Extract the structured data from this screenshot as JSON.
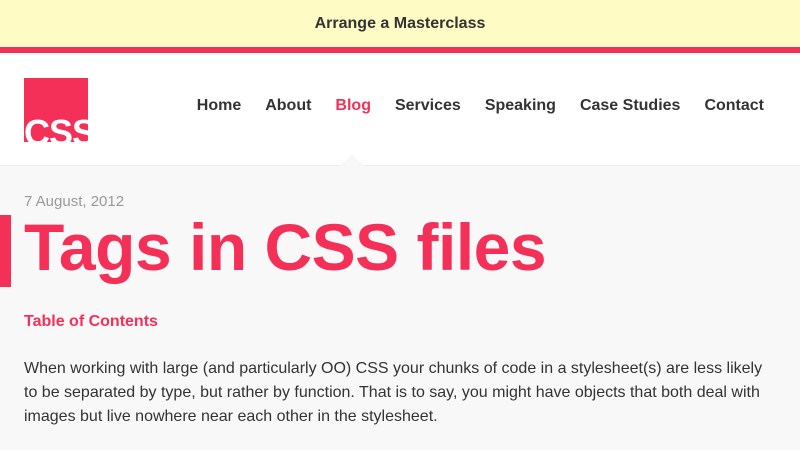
{
  "promo": {
    "label": "Arrange a Masterclass"
  },
  "header": {
    "logo_text": "CSS",
    "nav": [
      {
        "label": "Home"
      },
      {
        "label": "About"
      },
      {
        "label": "Blog",
        "active": true
      },
      {
        "label": "Services"
      },
      {
        "label": "Speaking"
      },
      {
        "label": "Case Studies"
      },
      {
        "label": "Contact"
      }
    ]
  },
  "post": {
    "date": "7 August, 2012",
    "title": "Tags in CSS files",
    "toc_label": "Table of Contents",
    "intro": "When working with large (and particularly OO) CSS your chunks of code in a stylesheet(s) are less likely to be separated by type, but rather by function. That is to say, you might have objects that both deal with images but live nowhere near each other in the stylesheet."
  },
  "colors": {
    "accent": "#f43059",
    "promo_background": "#fffbc5",
    "text": "#333333",
    "muted": "#999999",
    "page_background": "#f8f8f8"
  }
}
